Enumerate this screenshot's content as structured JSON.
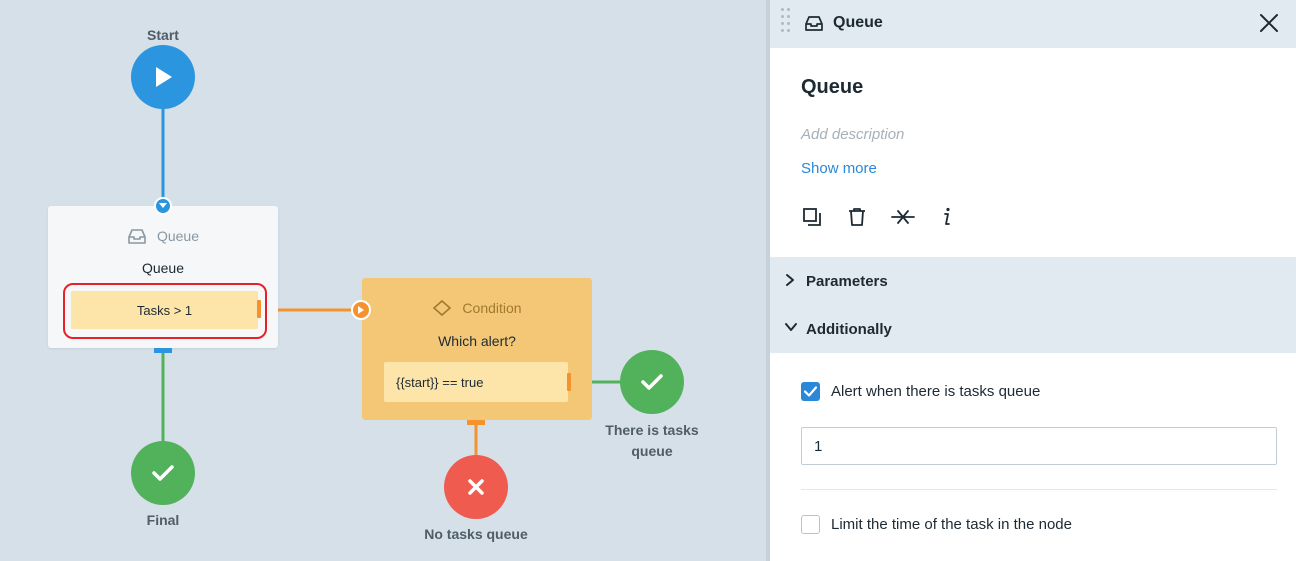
{
  "canvas": {
    "start": {
      "label": "Start",
      "icon": "play-icon"
    },
    "queue_node": {
      "type_label": "Queue",
      "title": "Queue",
      "rule": "Tasks > 1",
      "icon": "inbox-icon"
    },
    "condition_node": {
      "type_label": "Condition",
      "title": "Which alert?",
      "rule": "{{start}} == true",
      "icon": "diamond-icon"
    },
    "final": {
      "label": "Final",
      "icon": "check-icon"
    },
    "no_tasks": {
      "label": "No tasks queue",
      "icon": "x-icon"
    },
    "tasks_queue": {
      "label": "There is tasks queue",
      "icon": "check-icon"
    }
  },
  "panel": {
    "header_title": "Queue",
    "title": "Queue",
    "description_placeholder": "Add description",
    "show_more": "Show more",
    "toolbar": [
      "copy-icon",
      "trash-icon",
      "disconnect-icon",
      "info-icon"
    ],
    "sections": [
      {
        "label": "Parameters",
        "expanded": false
      },
      {
        "label": "Additionally",
        "expanded": true
      }
    ],
    "alert_checkbox": {
      "label": "Alert when there is tasks queue",
      "checked": true
    },
    "alert_value": "1",
    "limit_checkbox": {
      "label": "Limit the time of the task in the node",
      "checked": false
    }
  },
  "colors": {
    "blue": "#2b95e0",
    "green": "#52b25c",
    "red": "#ef5b4f",
    "orange": "#f5922e",
    "highlight": "#e8202a"
  }
}
